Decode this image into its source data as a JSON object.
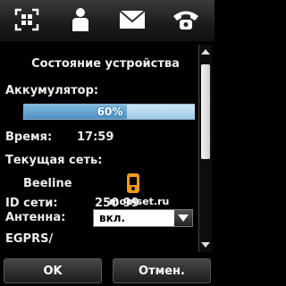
{
  "topbar": {
    "icons": [
      "scan-grid-icon",
      "contact-icon",
      "message-icon",
      "phone-icon"
    ]
  },
  "dialog": {
    "title": "Состояние устройства",
    "battery_label": "Аккумулятор:",
    "battery_percent": 60,
    "battery_text": "60%",
    "time_label": "Время:",
    "time_value": "17:59",
    "network_label": "Текущая сеть:",
    "network_value": "Beeline",
    "network_id_label": "ID сети:",
    "network_id_value": "250 99",
    "antenna_label": "Антенна:",
    "antenna_value": "вкл.",
    "egprs_label": "EGPRS/"
  },
  "softkeys": {
    "ok_label": "OK",
    "cancel_label": "Отмен."
  },
  "watermark": {
    "text": "mobiset.ru"
  },
  "colors": {
    "background": "#000000",
    "battery_fill": "#4e8fc2",
    "battery_track": "#9cc9e6",
    "logo_orange": "#f39a1b"
  }
}
